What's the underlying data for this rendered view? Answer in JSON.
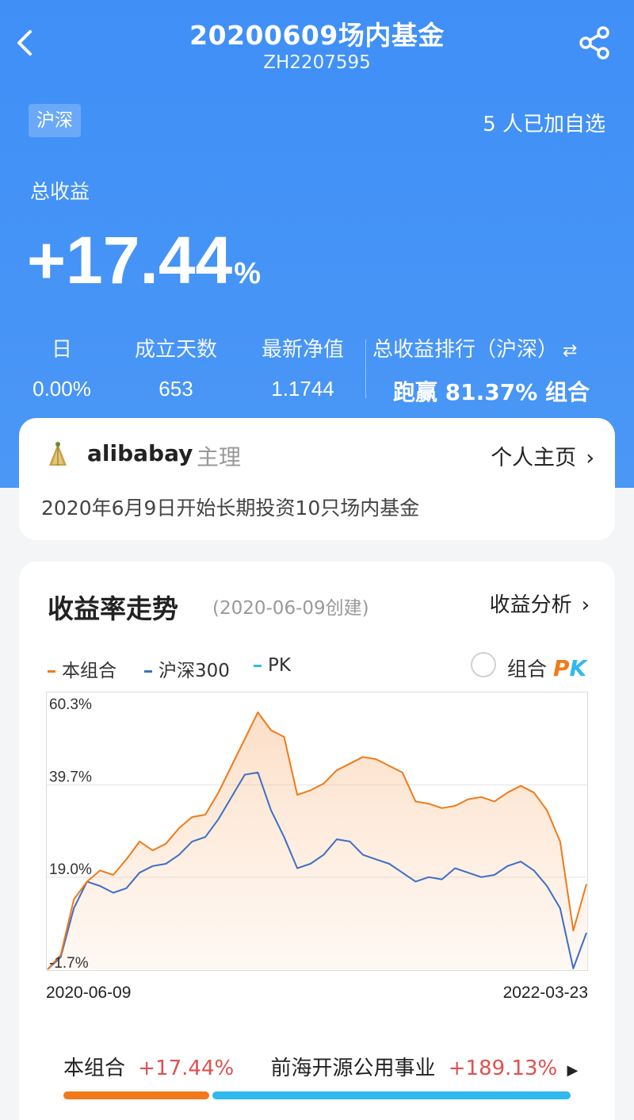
{
  "header": {
    "title": "20200609场内基金",
    "code": "ZH2207595",
    "market_tag": "沪深",
    "follow_text": "5 人已加自选"
  },
  "summary": {
    "total_label": "总收益",
    "total_value": "+17.44",
    "total_unit": "%",
    "stats": [
      {
        "label": "日",
        "value": "0.00%"
      },
      {
        "label": "成立天数",
        "value": "653"
      },
      {
        "label": "最新净值",
        "value": "1.1744"
      }
    ],
    "rank_label": "总收益排行（沪深）",
    "rank_value": "跑赢 81.37% 组合"
  },
  "manager": {
    "name": "alibabay",
    "role": "主理",
    "home_link": "个人主页",
    "description": "2020年6月9日开始长期投资10只场内基金"
  },
  "chart_section": {
    "title": "收益率走势",
    "created": "(2020-06-09创建)",
    "analysis_link": "收益分析",
    "pk_toggle_label": "组合",
    "pk_toggle_mark": "PK"
  },
  "colors": {
    "portfolio": "#f07a1a",
    "index": "#3d6fc4",
    "pk": "#2fb9ee",
    "hero": "#4a97f6"
  },
  "chart_data": {
    "type": "line",
    "series": [
      {
        "name": "本组合",
        "values": [
          -1.7,
          1.5,
          14.0,
          18.0,
          20.5,
          19.5,
          23.0,
          27.0,
          25.0,
          26.5,
          30.0,
          32.5,
          33.0,
          38.0,
          44.0,
          50.0,
          56.0,
          52.0,
          50.5,
          37.5,
          38.5,
          40.0,
          43.0,
          44.5,
          46.0,
          45.5,
          44.0,
          42.5,
          36.0,
          35.5,
          34.5,
          35.0,
          36.5,
          37.0,
          36.0,
          38.0,
          39.5,
          38.0,
          34.0,
          27.0,
          7.0,
          17.44
        ]
      },
      {
        "name": "沪深300",
        "values": [
          -1.7,
          1.0,
          12.0,
          18.0,
          17.0,
          15.5,
          16.5,
          20.0,
          21.5,
          22.0,
          24.0,
          27.0,
          28.0,
          32.0,
          37.0,
          42.0,
          42.5,
          34.0,
          28.0,
          21.0,
          22.0,
          24.0,
          27.5,
          27.0,
          24.0,
          23.0,
          22.0,
          20.0,
          18.0,
          19.0,
          18.5,
          21.0,
          20.0,
          19.0,
          19.5,
          21.5,
          22.5,
          20.5,
          17.0,
          12.0,
          -1.5,
          6.5
        ]
      },
      {
        "name": "PK",
        "values": []
      }
    ],
    "y_ticks": [
      "60.3%",
      "39.7%",
      "19.0%",
      "-1.7%"
    ],
    "ylim": [
      -1.7,
      60.3
    ],
    "x_labels": [
      "2020-06-09",
      "2022-03-23"
    ],
    "grid": true,
    "legend": "top-left"
  },
  "compare": {
    "self_label": "本组合",
    "self_value": "+17.44%",
    "other_label": "前海开源公用事业",
    "other_value": "+189.13%"
  }
}
